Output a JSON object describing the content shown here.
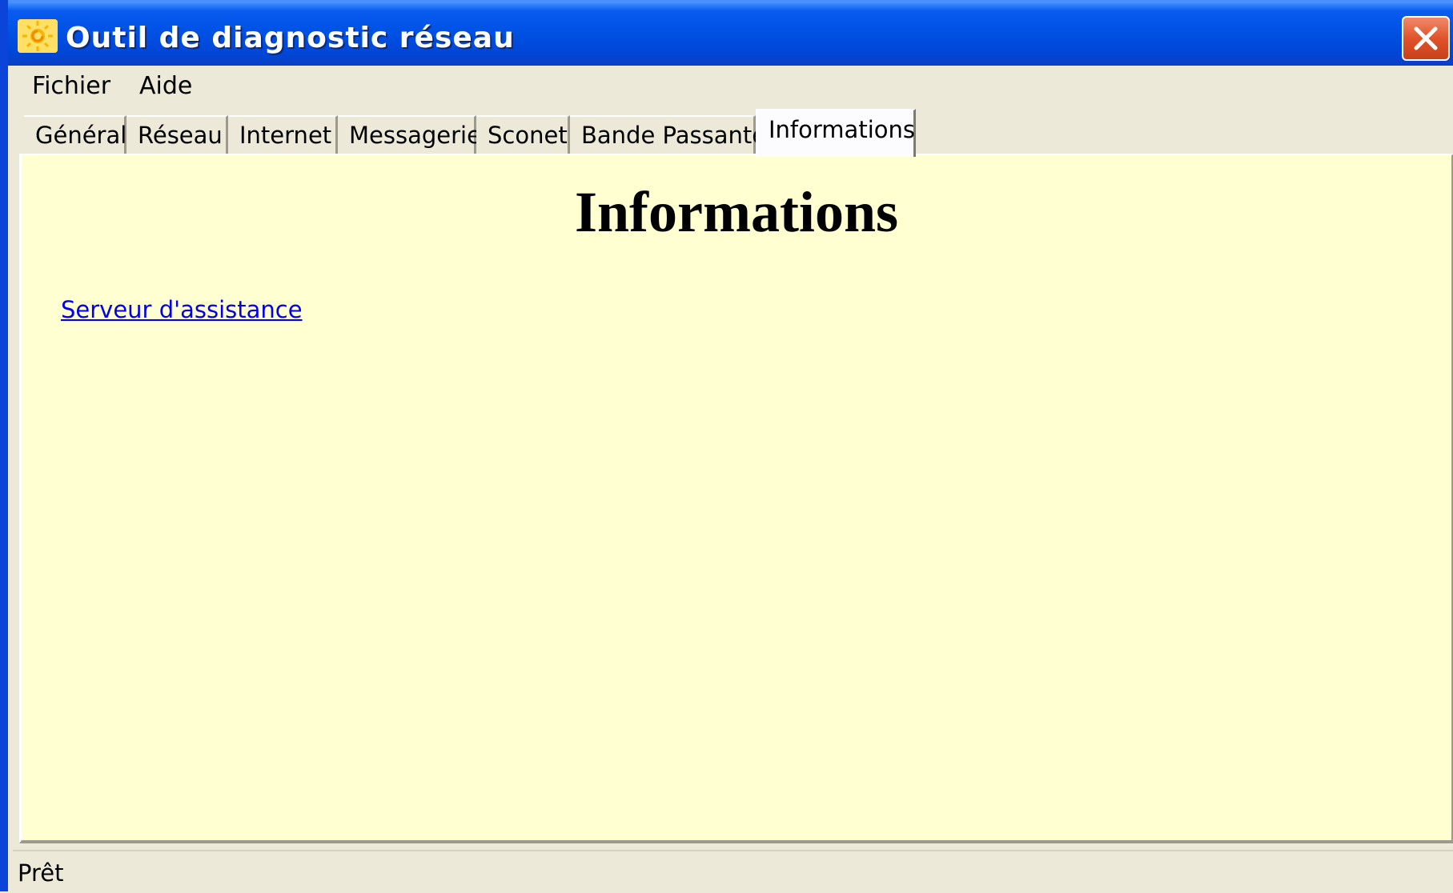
{
  "window": {
    "title": "Outil de diagnostic réseau"
  },
  "menu": {
    "items": [
      "Fichier",
      "Aide"
    ]
  },
  "tabs": [
    {
      "label": "Général",
      "active": false
    },
    {
      "label": "Réseau",
      "active": false
    },
    {
      "label": "Internet",
      "active": false
    },
    {
      "label": "Messagerie",
      "active": false
    },
    {
      "label": "Sconet",
      "active": false
    },
    {
      "label": "Bande Passante",
      "active": false
    },
    {
      "label": "Informations",
      "active": true
    }
  ],
  "content": {
    "heading": "Informations",
    "link": "Serveur d'assistance",
    "background": "#ffffd2",
    "link_color": "#0000ee"
  },
  "status": {
    "text": "Prêt"
  },
  "icons": {
    "app": "app-sun-icon",
    "close": "close-icon"
  },
  "colors": {
    "titlebar": "#0053e6",
    "close_button": "#e0532a",
    "chrome": "#ece9d8"
  }
}
